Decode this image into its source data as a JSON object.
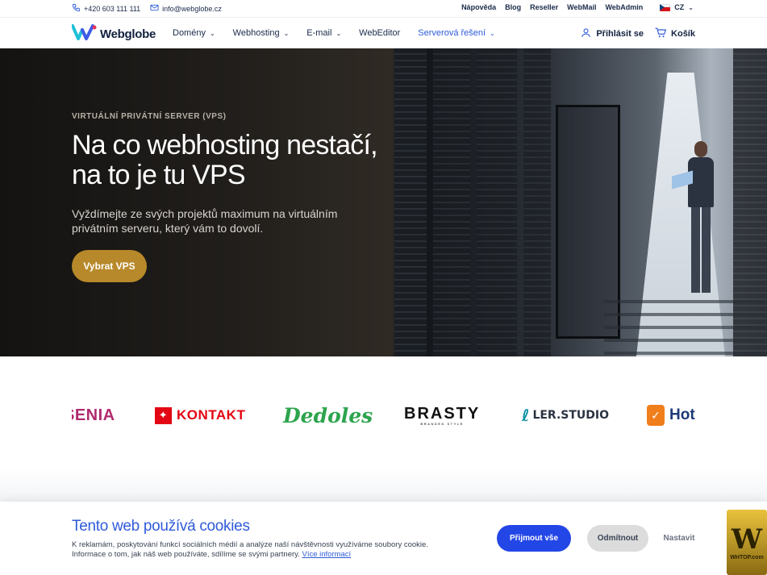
{
  "topbar": {
    "phone": "+420 603 111 111",
    "email": "info@webglobe.cz",
    "links": [
      "Nápověda",
      "Blog",
      "Reseller",
      "WebMail",
      "WebAdmin"
    ],
    "lang": "CZ"
  },
  "header": {
    "brand": "Webglobe",
    "nav": [
      {
        "label": "Domény"
      },
      {
        "label": "Webhosting"
      },
      {
        "label": "E-mail"
      },
      {
        "label": "WebEditor"
      },
      {
        "label": "Serverová řešení"
      }
    ],
    "login": "Přihlásit se",
    "cart": "Košík"
  },
  "hero": {
    "eyebrow": "VIRTUÁLNÍ PRIVÁTNÍ SERVER (VPS)",
    "title": "Na co webhosting nestačí, na to je tu VPS",
    "subtitle": "Vyždímejte ze svých projektů maximum na virtuálním privátním serveru, který vám to dovolí.",
    "cta": "Vybrat VPS"
  },
  "clients": {
    "ksenia": "SENIA",
    "kontakt": "KONTAKT",
    "dedoles": "Dedoles",
    "brasty": "BRASTY",
    "brasty_tag": "BRANDED STYLE",
    "ler": "LER.STUDIO",
    "hot": "Hot"
  },
  "cookie": {
    "title": "Tento web používá cookies",
    "text": "K reklamám, poskytování funkcí sociálních médií a analýze naší návštěvnosti využíváme soubory cookie. Informace o tom, jak náš web používáte, sdílíme se svými partnery.",
    "link": "Více informací",
    "accept": "Přijmout vše",
    "decline": "Odmítnout",
    "settings": "Nastavit"
  },
  "watermark": {
    "mark": "W",
    "site": "WHTOP.com"
  },
  "colors": {
    "accent": "#2f5bd8",
    "cta": "#b8892a",
    "accept_button": "#2346e6"
  }
}
